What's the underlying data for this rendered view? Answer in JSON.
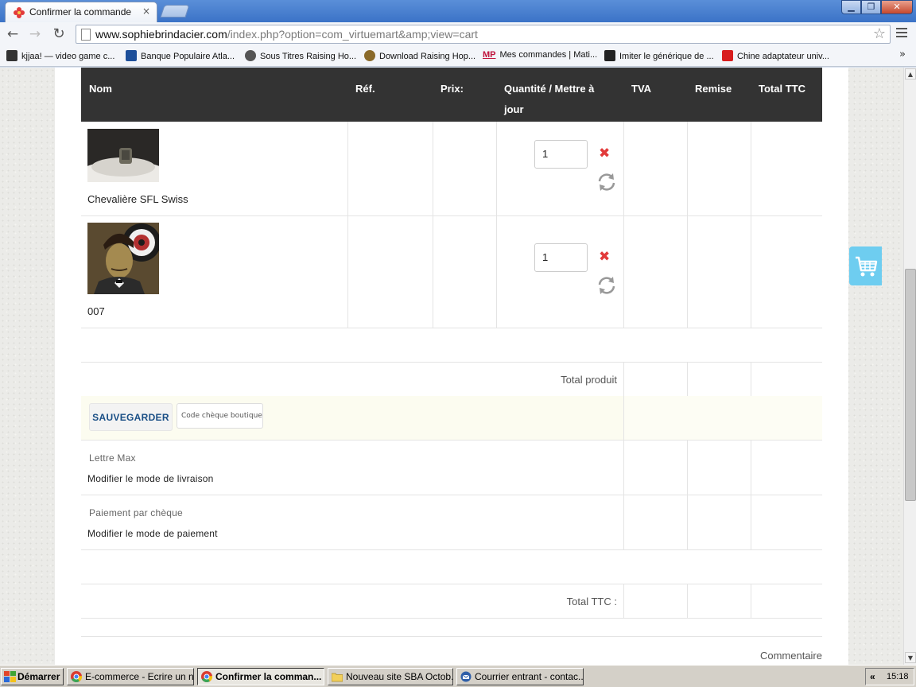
{
  "browser": {
    "tab_title": "Confirmer la commande",
    "tab_close": "×",
    "url_host": "www.sophiebrindacier.com",
    "url_path": "/index.php?option=com_virtuemart&amp;view=cart",
    "nav_back": "←",
    "nav_forward": "→",
    "nav_reload": "↻",
    "star": "☆",
    "window_buttons": {
      "minimize": "▁",
      "maximize": "❐",
      "close": "✕"
    },
    "bookmarks": [
      {
        "label": "kjjaa! — video game c...",
        "icon": "kjjaa-icon",
        "color": "#333333"
      },
      {
        "label": "Banque Populaire Atla...",
        "icon": "banque-populaire-icon",
        "color": "#1d4f9a"
      },
      {
        "label": "Sous Titres Raising Ho...",
        "icon": "tv-icon",
        "color": "#555555"
      },
      {
        "label": "Download Raising Hop...",
        "icon": "torrent-icon",
        "color": "#8a6a2a"
      },
      {
        "label": "Mes commandes | Mati...",
        "icon": "mp-icon",
        "color": "#c0143c",
        "prefix": "MP"
      },
      {
        "label": "Imiter le générique de ...",
        "icon": "clapper-icon",
        "color": "#222222"
      },
      {
        "label": "Chine adaptateur univ...",
        "icon": "m-logo-icon",
        "color": "#d81e1e"
      }
    ],
    "bookmarks_more": "»"
  },
  "cart": {
    "headers": {
      "name": "Nom",
      "ref": "Réf.",
      "price": "Prix:",
      "qty_line1": "Quantité / Mettre à",
      "qty_line2": "jour",
      "tva": "TVA",
      "discount": "Remise",
      "total": "Total TTC"
    },
    "items": [
      {
        "name": "Chevalière SFL Swiss",
        "quantity": "1",
        "image": "ring-photo"
      },
      {
        "name": "007",
        "quantity": "1",
        "image": "portrait-painting"
      }
    ],
    "delete_glyph": "✖",
    "total_product_label": "Total produit",
    "save_button": "SAUVEGARDER",
    "coupon_placeholder": "Code chèque boutique",
    "shipping_title": "Lettre Max",
    "shipping_change": "Modifier le mode de livraison",
    "payment_title": "Paiement par chèque",
    "payment_change": "Modifier le mode de paiement",
    "total_ttc_label": "Total TTC :",
    "comment_label": "Commentaire"
  },
  "scrollbar": {
    "up": "▲",
    "down": "▼"
  },
  "taskbar": {
    "start_label": "Démarrer",
    "tasks": [
      {
        "label": "E-commerce - Ecrire un n...",
        "icon": "chrome-icon",
        "active": false
      },
      {
        "label": "Confirmer la comman...",
        "icon": "chrome-icon",
        "active": true
      },
      {
        "label": "Nouveau site SBA Octob...",
        "icon": "folder-icon",
        "active": false
      },
      {
        "label": "Courrier entrant - contac...",
        "icon": "thunderbird-icon",
        "active": false
      }
    ],
    "tray_arrows": "«",
    "clock": "15:18"
  }
}
